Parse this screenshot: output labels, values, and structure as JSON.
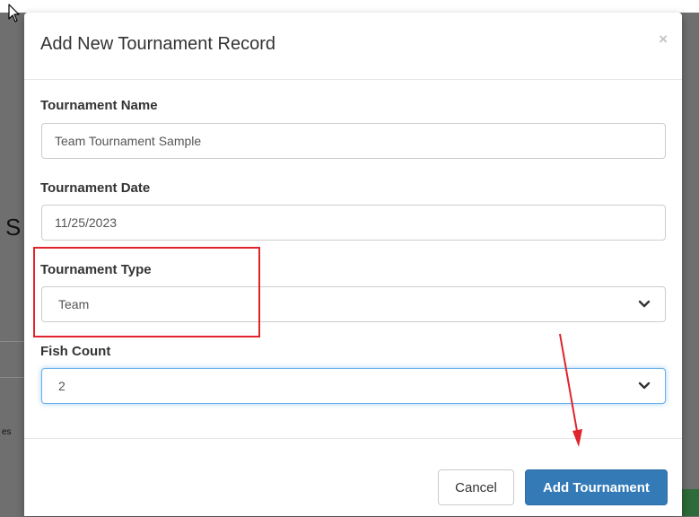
{
  "modal": {
    "title": "Add New Tournament Record",
    "close_symbol": "×"
  },
  "fields": {
    "name": {
      "label": "Tournament Name",
      "value": "Team Tournament Sample"
    },
    "date": {
      "label": "Tournament Date",
      "value": "11/25/2023"
    },
    "type": {
      "label": "Tournament Type",
      "selected": "Team"
    },
    "fish_count": {
      "label": "Fish Count",
      "selected": "2"
    }
  },
  "footer": {
    "cancel_label": "Cancel",
    "submit_label": "Add Tournament"
  },
  "background": {
    "partial_heading": "S",
    "partial_text": "es"
  },
  "colors": {
    "primary": "#337ab7",
    "focus": "#66afe9",
    "annotation": "#e0242c",
    "overlay": "#6f6f6f"
  },
  "icons": [
    "mouse-cursor-icon",
    "close-icon",
    "chevron-down-icon",
    "annotation-arrow-icon"
  ]
}
